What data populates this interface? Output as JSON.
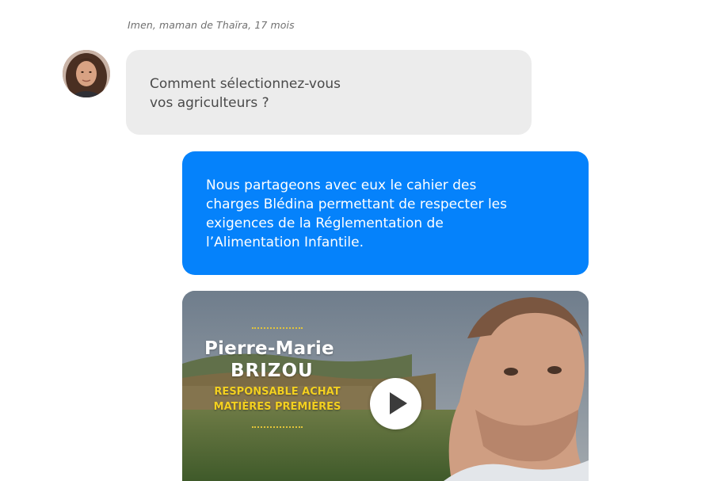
{
  "conversation": {
    "author_caption": "Imen, maman de Thaïra, 17 mois",
    "question": {
      "line1": "Comment sélectionnez-vous",
      "line2": "vos agriculteurs ?"
    },
    "answer": {
      "line1": "Nous partageons avec eux le cahier des",
      "line2": "charges Blédina permettant de respecter les",
      "line3": "exigences de la Réglementation de",
      "line4": "l’Alimentation Infantile."
    }
  },
  "video": {
    "first_name": "Pierre-Marie",
    "last_name": "BRIZOU",
    "role_line1": "RESPONSABLE ACHAT",
    "role_line2": "MATIÈRES PREMIÈRES",
    "play_icon": "play-icon"
  },
  "colors": {
    "question_bubble": "#ececec",
    "answer_bubble": "#0582fb",
    "role_text": "#f3d020"
  }
}
